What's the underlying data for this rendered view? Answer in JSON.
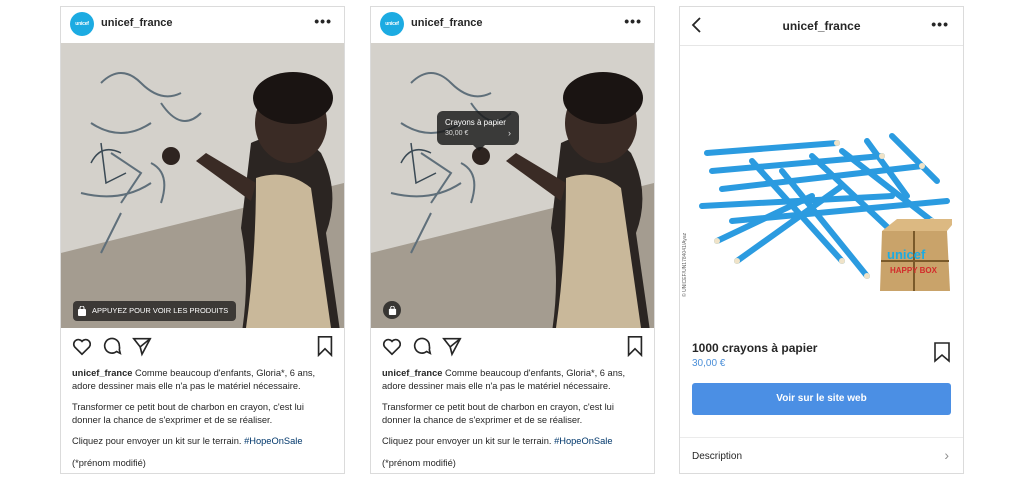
{
  "post": {
    "username": "unicef_france",
    "avatar_text": "unicef",
    "more": "•••",
    "shop_pill": "APPUYEZ POUR VOIR LES PRODUITS",
    "caption_user": "unicef_france",
    "caption_p1": " Comme beaucoup d'enfants, Gloria*, 6 ans, adore dessiner mais elle n'a pas le matériel nécessaire.",
    "caption_p2": "Transformer ce petit bout de charbon en crayon, c'est lui donner la chance de s'exprimer et de se réaliser.",
    "caption_p3": "Cliquez pour envoyer un kit sur le terrain. ",
    "hashtag": "#HopeOnSale",
    "caption_p4": "(*prénom modifié)"
  },
  "product_tag": {
    "title": "Crayons à papier",
    "price": "30,00 €",
    "chevron": "›"
  },
  "product_page": {
    "username": "unicef_france",
    "more": "•••",
    "name": "1000 crayons à papier",
    "price": "30,00 €",
    "button": "Voir sur le site web",
    "description": "Description",
    "chevron": "›",
    "credit": "© UNICEF/UN1784041/Ayaz",
    "box_brand": "unicef",
    "box_line": "HAPPY BOX"
  },
  "colors": {
    "accent": "#4b8fe4",
    "unicef_blue": "#1cabe2",
    "pencil_blue": "#2b9be0"
  }
}
